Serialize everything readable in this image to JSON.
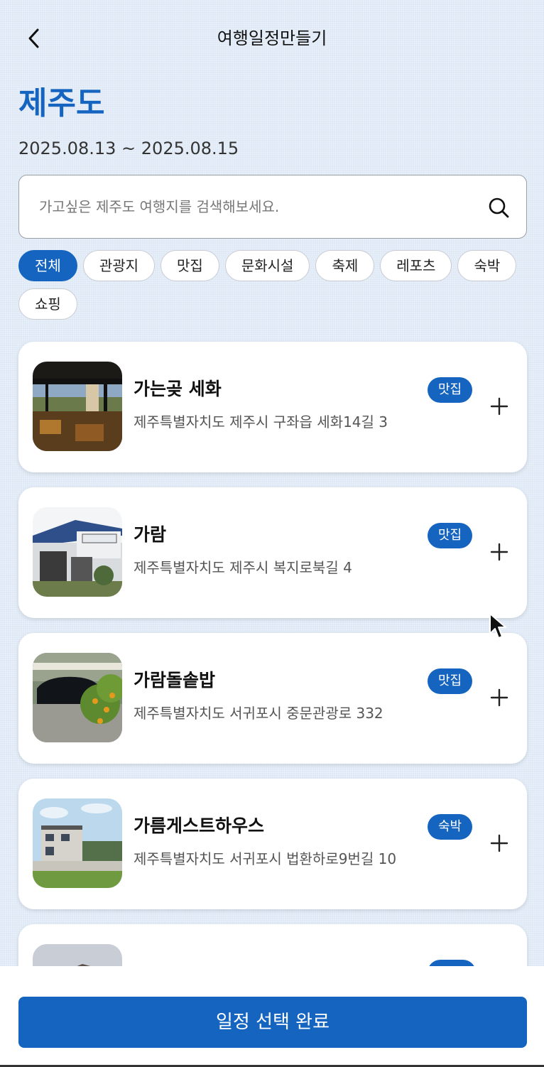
{
  "header": {
    "title": "여행일정만들기",
    "back_icon": "chevron-left-icon"
  },
  "region": {
    "name": "제주도",
    "date_range": "2025.08.13 ~ 2025.08.15"
  },
  "search": {
    "placeholder": "가고싶은 제주도 여행지를 검색해보세요.",
    "value": "",
    "icon": "search-icon"
  },
  "categories": [
    {
      "label": "전체",
      "active": true
    },
    {
      "label": "관광지",
      "active": false
    },
    {
      "label": "맛집",
      "active": false
    },
    {
      "label": "문화시설",
      "active": false
    },
    {
      "label": "축제",
      "active": false
    },
    {
      "label": "레포츠",
      "active": false
    },
    {
      "label": "숙박",
      "active": false
    },
    {
      "label": "쇼핑",
      "active": false
    }
  ],
  "places": [
    {
      "name": "가는곶 세화",
      "address": "제주특별자치도 제주시 구좌읍 세화14길 3",
      "category": "맛집"
    },
    {
      "name": "가람",
      "address": "제주특별자치도 제주시 복지로북길 4",
      "category": "맛집"
    },
    {
      "name": "가람돌솥밥",
      "address": "제주특별자치도 서귀포시 중문관광로 332",
      "category": "맛집"
    },
    {
      "name": "가름게스트하우스",
      "address": "제주특별자치도 서귀포시 법환하로9번길 10",
      "category": "숙박"
    }
  ],
  "footer": {
    "complete_label": "일정 선택 완료"
  },
  "colors": {
    "accent": "#1565c0",
    "background": "#dfe9f6"
  }
}
